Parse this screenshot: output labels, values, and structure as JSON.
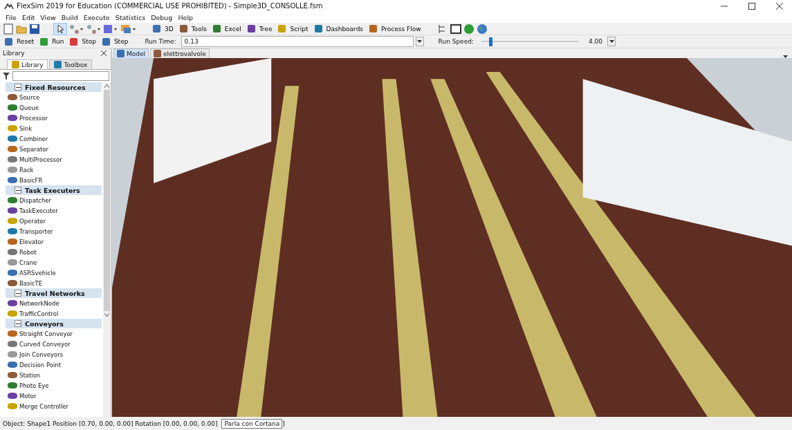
{
  "window": {
    "title": "FlexSim 2019 for Education (COMMERCIAL USE PROHIBITED) - Simple3D_CONSOLLE.fsm"
  },
  "menu": [
    "File",
    "Edit",
    "View",
    "Build",
    "Execute",
    "Statistics",
    "Debug",
    "Help"
  ],
  "toolbar": [
    "3D",
    "Tools",
    "Excel",
    "Tree",
    "Script",
    "Dashboards",
    "Process Flow"
  ],
  "run_bar": {
    "buttons": [
      "Reset",
      "Run",
      "Stop",
      "Step"
    ],
    "run_time_label": "Run Time:",
    "run_time": "0.13",
    "speed_label": "Run Speed:",
    "speed": {
      "level": 0.08
    },
    "speed_value": "4.00"
  },
  "library": {
    "title": "Library",
    "tabs": [
      {
        "label": "Library",
        "selected": true
      },
      {
        "label": "Toolbox",
        "selected": false
      }
    ],
    "items": [
      {
        "kind": "header",
        "label": "Fixed Resources",
        "expanded": true
      },
      {
        "kind": "item",
        "label": "Source"
      },
      {
        "kind": "item",
        "label": "Queue"
      },
      {
        "kind": "item",
        "label": "Processor"
      },
      {
        "kind": "item",
        "label": "Sink"
      },
      {
        "kind": "item",
        "label": "Combiner"
      },
      {
        "kind": "item",
        "label": "Separator"
      },
      {
        "kind": "item",
        "label": "MultiProcessor"
      },
      {
        "kind": "item",
        "label": "Rack"
      },
      {
        "kind": "item",
        "label": "BasicFR"
      },
      {
        "kind": "header",
        "label": "Task Executers",
        "expanded": true
      },
      {
        "kind": "item",
        "label": "Dispatcher"
      },
      {
        "kind": "item",
        "label": "TaskExecuter"
      },
      {
        "kind": "item",
        "label": "Operator"
      },
      {
        "kind": "item",
        "label": "Transporter"
      },
      {
        "kind": "item",
        "label": "Elevator"
      },
      {
        "kind": "item",
        "label": "Robot"
      },
      {
        "kind": "item",
        "label": "Crane"
      },
      {
        "kind": "item",
        "label": "ASRSvehicle"
      },
      {
        "kind": "item",
        "label": "BasicTE"
      },
      {
        "kind": "header",
        "label": "Travel Networks",
        "expanded": true
      },
      {
        "kind": "item",
        "label": "NetworkNode"
      },
      {
        "kind": "item",
        "label": "TrafficControl"
      },
      {
        "kind": "header",
        "label": "Conveyors",
        "expanded": true
      },
      {
        "kind": "item",
        "label": "Straight Conveyor"
      },
      {
        "kind": "item",
        "label": "Curved Conveyor"
      },
      {
        "kind": "item",
        "label": "Join Conveyors"
      },
      {
        "kind": "item",
        "label": "Decision Point"
      },
      {
        "kind": "item",
        "label": "Station"
      },
      {
        "kind": "item",
        "label": "Photo Eye"
      },
      {
        "kind": "item",
        "label": "Motor"
      },
      {
        "kind": "item",
        "label": "Merge Controller"
      }
    ]
  },
  "doc_tabs": [
    {
      "label": "Model",
      "selected": true
    },
    {
      "label": "elettrovalvole",
      "selected": false
    }
  ],
  "status_bar": {
    "text": "Object: Shape1 Position [0.70, 0.00, 0.00]  Rotation [0.00, 0.00, 0.00]",
    "tail": "]"
  },
  "tooltip": "Parla con Cortana"
}
